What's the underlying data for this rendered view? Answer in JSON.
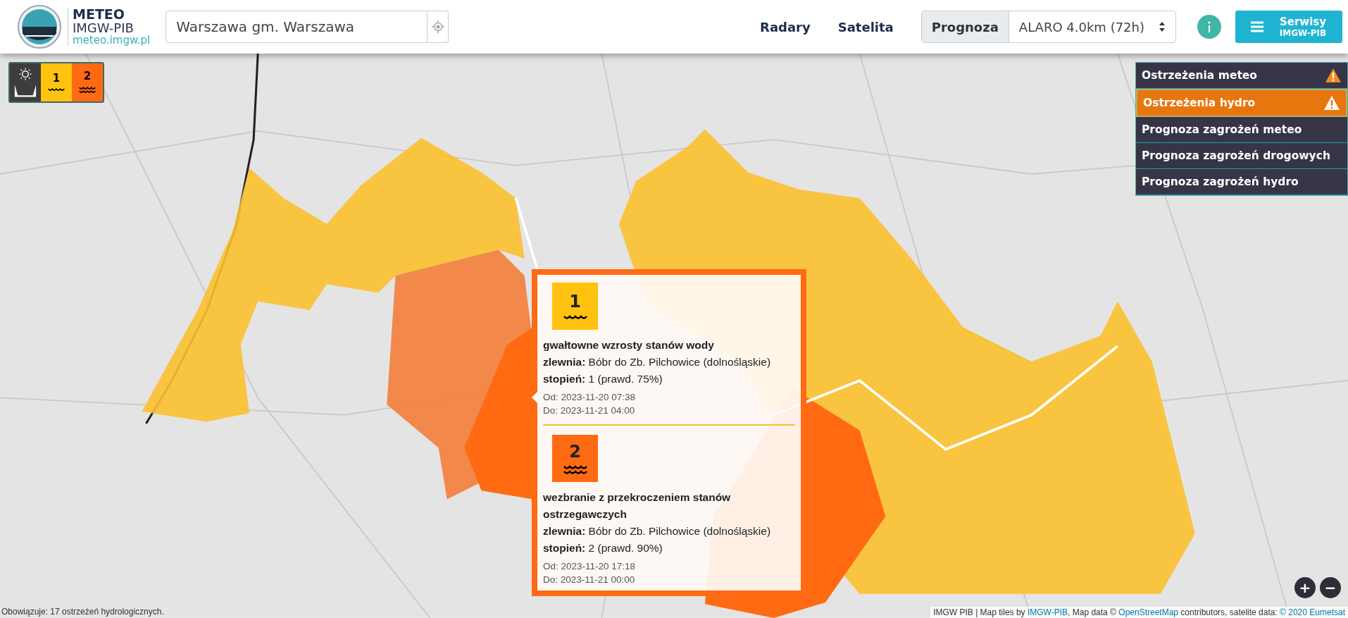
{
  "header": {
    "logo": {
      "title": "METEO",
      "subtitle": "IMGW-PIB",
      "url": "meteo.imgw.pl"
    },
    "search": {
      "value": "Warszawa gm. Warszawa"
    },
    "nav": [
      {
        "label": "Radary"
      },
      {
        "label": "Satelita"
      }
    ],
    "forecast": {
      "label": "Prognoza",
      "value": "ALARO 4.0km (72h)"
    },
    "services_button": {
      "label": "Serwisy",
      "sublabel": "IMGW-PIB"
    }
  },
  "legend": [
    {
      "kind": "icon"
    },
    {
      "kind": "level",
      "label": "1",
      "color": "#ffc20e"
    },
    {
      "kind": "level",
      "label": "2",
      "color": "#ff6a13"
    }
  ],
  "warnings_menu": [
    {
      "label": "Ostrzeżenia meteo",
      "kind": "warning",
      "selected": false
    },
    {
      "label": "Ostrzeżenia hydro",
      "kind": "warning",
      "selected": true
    },
    {
      "label": "Prognoza zagrożeń meteo",
      "kind": "forecast",
      "selected": false
    },
    {
      "label": "Prognoza zagrożeń drogowych",
      "kind": "forecast",
      "selected": false
    },
    {
      "label": "Prognoza zagrożeń hydro",
      "kind": "forecast",
      "selected": false
    }
  ],
  "popup": {
    "warnings": [
      {
        "level": "1",
        "color": "#ffc20e",
        "title": "gwałtowne wzrosty stanów wody",
        "catchment": "**zlewnia:** Bóbr do Zb. Pilchowice (dolnośląskie)",
        "degree": "**stopień:** 1 (prawd. 75%)",
        "from": "Od: 2023-11-20 07:38",
        "to": "Do: 2023-11-21 04:00"
      },
      {
        "level": "2",
        "color": "#ff6a13",
        "title": "wezbranie z przekroczeniem stanów ostrzegawczych",
        "catchment": "**zlewnia:** Bóbr do Zb. Pilchowice (dolnośląskie)",
        "degree": "**stopień:** 2 (prawd. 90%)",
        "from": "Od: 2023-11-20 17:18",
        "to": "Do: 2023-11-21 00:00"
      }
    ]
  },
  "zoom_controls": [
    {
      "label": "+"
    },
    {
      "label": "−"
    }
  ],
  "status_bar": {
    "text": "Obowiązuje: 17 ostrzeżeń hydrologicznych.",
    "attribution": [
      {
        "text": "IMGW PIB | Map tiles by ",
        "link": false
      },
      {
        "text": "IMGW-PIB",
        "link": true
      },
      {
        "text": ", Map data © ",
        "link": false
      },
      {
        "text": "OpenStreetMap",
        "link": true
      },
      {
        "text": " contributors, satelite data: ",
        "link": false
      },
      {
        "text": "© 2020 Eumetsat",
        "link": true
      }
    ]
  }
}
